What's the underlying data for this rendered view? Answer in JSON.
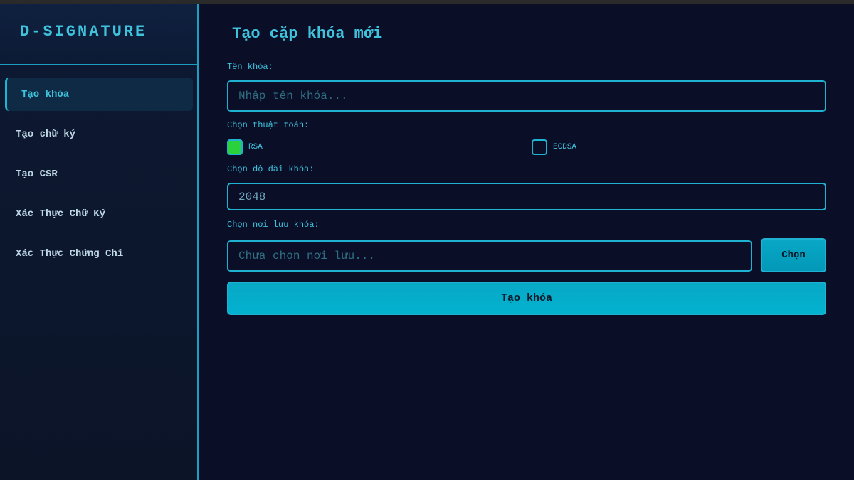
{
  "app": {
    "brand": "D-SIGNATURE"
  },
  "sidebar": {
    "items": [
      {
        "label": "Tạo khóa",
        "active": true
      },
      {
        "label": "Tạo chữ ký",
        "active": false
      },
      {
        "label": "Tạo CSR",
        "active": false
      },
      {
        "label": "Xác Thực Chữ Ký",
        "active": false
      },
      {
        "label": "Xác Thực Chứng Chỉ",
        "active": false
      }
    ]
  },
  "main": {
    "title": "Tạo cặp khóa mới",
    "key_name": {
      "label": "Tên khóa:",
      "placeholder": "Nhập tên khóa...",
      "value": ""
    },
    "algorithm": {
      "label": "Chọn thuật toán:",
      "options": [
        {
          "label": "RSA",
          "checked": true
        },
        {
          "label": "ECDSA",
          "checked": false
        }
      ]
    },
    "key_length": {
      "label": "Chọn độ dài khóa:",
      "value": "2048"
    },
    "save_location": {
      "label": "Chọn nơi lưu khóa:",
      "placeholder": "Chưa chọn nơi lưu...",
      "value": "",
      "choose_button": "Chọn"
    },
    "create_button": "Tạo khóa"
  },
  "colors": {
    "background": "#0a0e27",
    "accent": "#1fb3d1",
    "accent_text": "#3fc3dd",
    "checked": "#2bd13a"
  }
}
